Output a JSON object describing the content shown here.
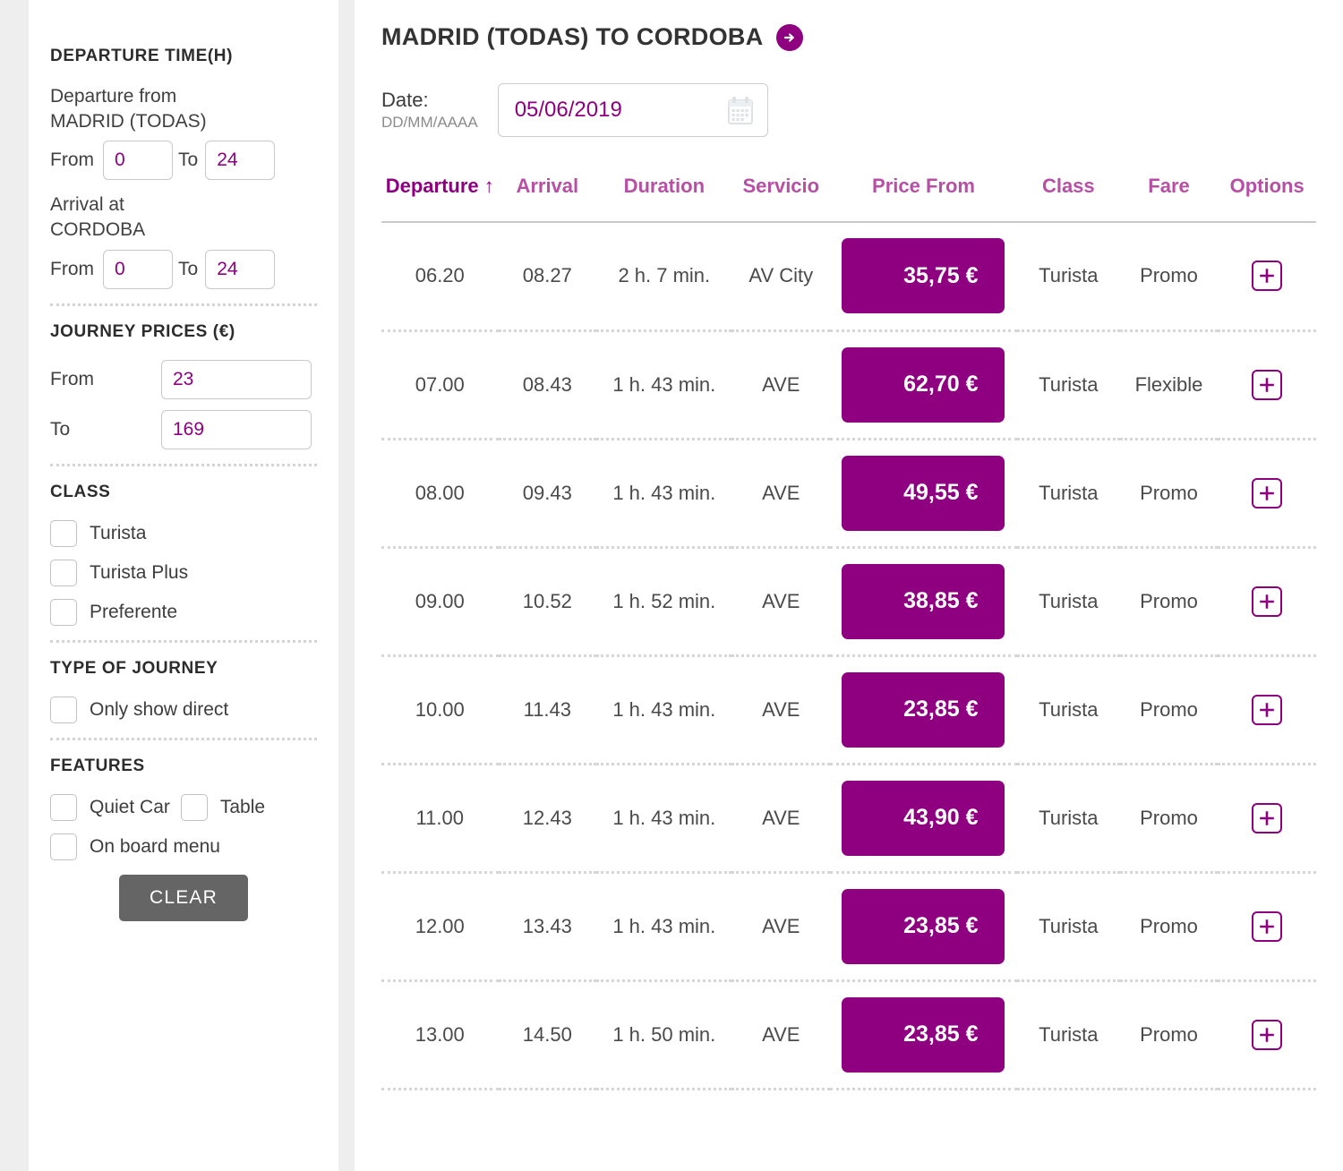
{
  "sidebar": {
    "departure_time": {
      "title": "DEPARTURE TIME(H)",
      "departure_from_label": "Departure from",
      "departure_from_station": "MADRID (TODAS)",
      "dep_from_label": "From",
      "dep_from_value": "0",
      "dep_to_label": "To",
      "dep_to_value": "24",
      "arrival_at_label": "Arrival at",
      "arrival_at_station": "CORDOBA",
      "arr_from_label": "From",
      "arr_from_value": "0",
      "arr_to_label": "To",
      "arr_to_value": "24"
    },
    "journey_prices": {
      "title": "JOURNEY PRICES (€)",
      "from_label": "From",
      "from_value": "23",
      "to_label": "To",
      "to_value": "169"
    },
    "class": {
      "title": "CLASS",
      "options": [
        {
          "label": "Turista",
          "checked": false
        },
        {
          "label": "Turista Plus",
          "checked": false
        },
        {
          "label": "Preferente",
          "checked": false
        }
      ]
    },
    "type_of_journey": {
      "title": "TYPE OF JOURNEY",
      "options": [
        {
          "label": "Only show direct",
          "checked": false
        }
      ]
    },
    "features": {
      "title": "FEATURES",
      "options": [
        {
          "label": "Quiet Car",
          "checked": false
        },
        {
          "label": "Table",
          "checked": false
        },
        {
          "label": "On board menu",
          "checked": false
        }
      ]
    },
    "clear_button": "CLEAR"
  },
  "main": {
    "route_title": "MADRID (TODAS) TO CORDOBA",
    "route_arrow_icon": "arrow-right-circle-icon",
    "date": {
      "label": "Date:",
      "format_hint": "DD/MM/AAAA",
      "value": "05/06/2019",
      "calendar_icon": "calendar-icon"
    },
    "table": {
      "columns": [
        {
          "key": "departure",
          "label": "Departure",
          "sort": "↑",
          "active": true
        },
        {
          "key": "arrival",
          "label": "Arrival",
          "sort": "",
          "active": false
        },
        {
          "key": "duration",
          "label": "Duration",
          "sort": "",
          "active": false
        },
        {
          "key": "servicio",
          "label": "Servicio",
          "sort": "",
          "active": false
        },
        {
          "key": "price",
          "label": "Price From",
          "sort": "",
          "active": false
        },
        {
          "key": "class",
          "label": "Class",
          "sort": "",
          "active": false
        },
        {
          "key": "fare",
          "label": "Fare",
          "sort": "",
          "active": false
        },
        {
          "key": "options",
          "label": "Options",
          "sort": "",
          "active": false
        }
      ],
      "rows": [
        {
          "departure": "06.20",
          "arrival": "08.27",
          "duration": "2 h. 7 min.",
          "servicio": "AV City",
          "price": "35,75 €",
          "class": "Turista",
          "fare": "Promo",
          "options_icon": "plus-icon"
        },
        {
          "departure": "07.00",
          "arrival": "08.43",
          "duration": "1 h. 43 min.",
          "servicio": "AVE",
          "price": "62,70 €",
          "class": "Turista",
          "fare": "Flexible",
          "options_icon": "plus-icon"
        },
        {
          "departure": "08.00",
          "arrival": "09.43",
          "duration": "1 h. 43 min.",
          "servicio": "AVE",
          "price": "49,55 €",
          "class": "Turista",
          "fare": "Promo",
          "options_icon": "plus-icon"
        },
        {
          "departure": "09.00",
          "arrival": "10.52",
          "duration": "1 h. 52 min.",
          "servicio": "AVE",
          "price": "38,85 €",
          "class": "Turista",
          "fare": "Promo",
          "options_icon": "plus-icon"
        },
        {
          "departure": "10.00",
          "arrival": "11.43",
          "duration": "1 h. 43 min.",
          "servicio": "AVE",
          "price": "23,85 €",
          "class": "Turista",
          "fare": "Promo",
          "options_icon": "plus-icon"
        },
        {
          "departure": "11.00",
          "arrival": "12.43",
          "duration": "1 h. 43 min.",
          "servicio": "AVE",
          "price": "43,90 €",
          "class": "Turista",
          "fare": "Promo",
          "options_icon": "plus-icon"
        },
        {
          "departure": "12.00",
          "arrival": "13.43",
          "duration": "1 h. 43 min.",
          "servicio": "AVE",
          "price": "23,85 €",
          "class": "Turista",
          "fare": "Promo",
          "options_icon": "plus-icon"
        },
        {
          "departure": "13.00",
          "arrival": "14.50",
          "duration": "1 h. 50 min.",
          "servicio": "AVE",
          "price": "23,85 €",
          "class": "Turista",
          "fare": "Promo",
          "options_icon": "plus-icon"
        }
      ]
    }
  },
  "colors": {
    "brand_purple": "#8e0080",
    "header_purple": "#b74fa4",
    "clear_gray": "#656565",
    "text_dark": "#333333"
  }
}
